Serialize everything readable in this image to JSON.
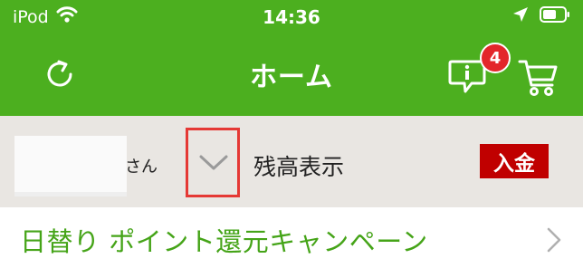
{
  "status_bar": {
    "carrier": "iPod",
    "time": "14:36",
    "icons": [
      "wifi-icon",
      "location-icon",
      "battery-icon"
    ]
  },
  "nav": {
    "title": "ホーム",
    "notification_count": "4",
    "icons": [
      "refresh-icon",
      "info-icon",
      "cart-icon"
    ]
  },
  "account": {
    "honorific": "さん",
    "balance_label": "残高表示",
    "deposit_label": "入金"
  },
  "promo": {
    "label": "日替り ポイント還元キャンペーン"
  },
  "colors": {
    "brand_green": "#4caf1f",
    "promo_green": "#45a418",
    "deposit_red": "#c00000",
    "badge_red": "#e3262a",
    "highlight_red": "#e53935",
    "account_bg": "#e9e6e2"
  }
}
